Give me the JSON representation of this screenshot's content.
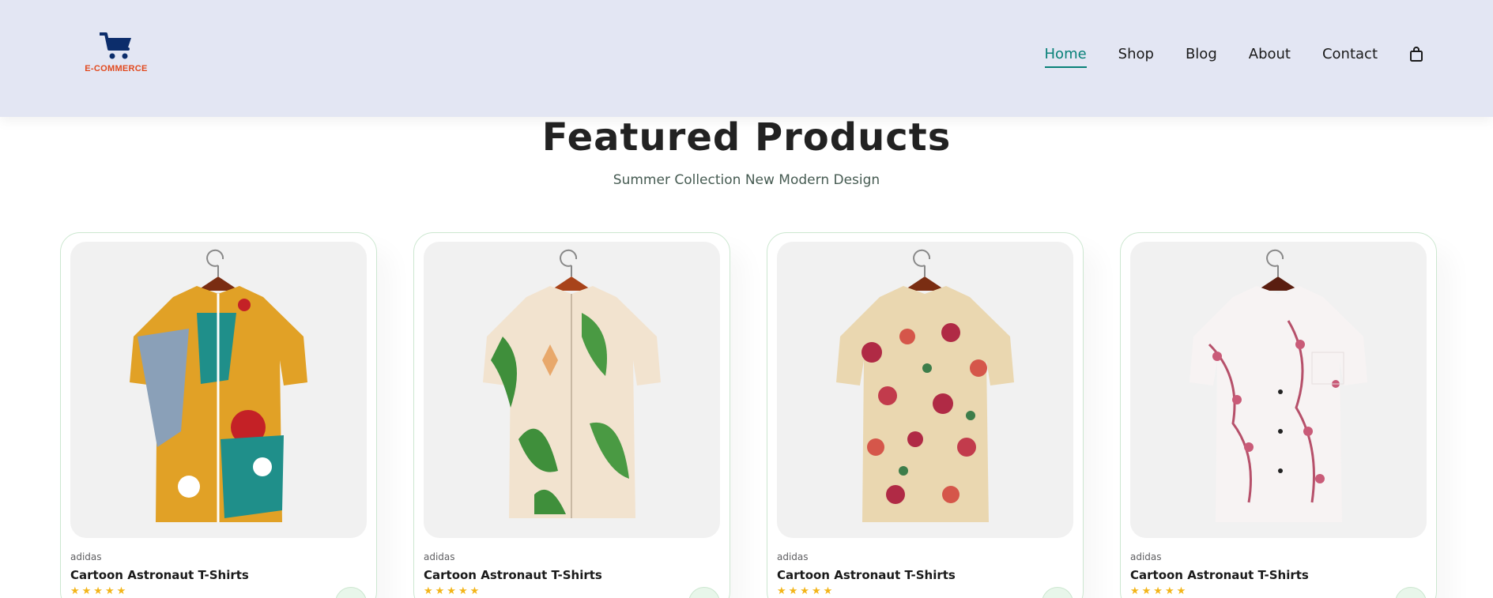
{
  "logo": {
    "text": "E-COMMERCE",
    "icon": "shopping-cart-icon",
    "text_color": "#e24a1f",
    "icon_color": "#0c2d6b"
  },
  "nav": {
    "items": [
      {
        "label": "Home",
        "active": true
      },
      {
        "label": "Shop"
      },
      {
        "label": "Blog"
      },
      {
        "label": "About"
      },
      {
        "label": "Contact"
      }
    ],
    "bag_icon": "shopping-bag-icon"
  },
  "featured": {
    "title": "Featured Products",
    "subtitle": "Summer Collection New Modern Design"
  },
  "products": [
    {
      "brand": "adidas",
      "name": "Cartoon Astronaut T-Shirts",
      "stars": "★★★★★"
    },
    {
      "brand": "adidas",
      "name": "Cartoon Astronaut T-Shirts",
      "stars": "★★★★★"
    },
    {
      "brand": "adidas",
      "name": "Cartoon Astronaut T-Shirts",
      "stars": "★★★★★"
    },
    {
      "brand": "adidas",
      "name": "Cartoon Astronaut T-Shirts",
      "stars": "★★★★★"
    }
  ],
  "colors": {
    "header_bg": "#e3e6f3",
    "accent": "#088178",
    "star": "#f3b519",
    "card_border": "#cce7d0"
  }
}
